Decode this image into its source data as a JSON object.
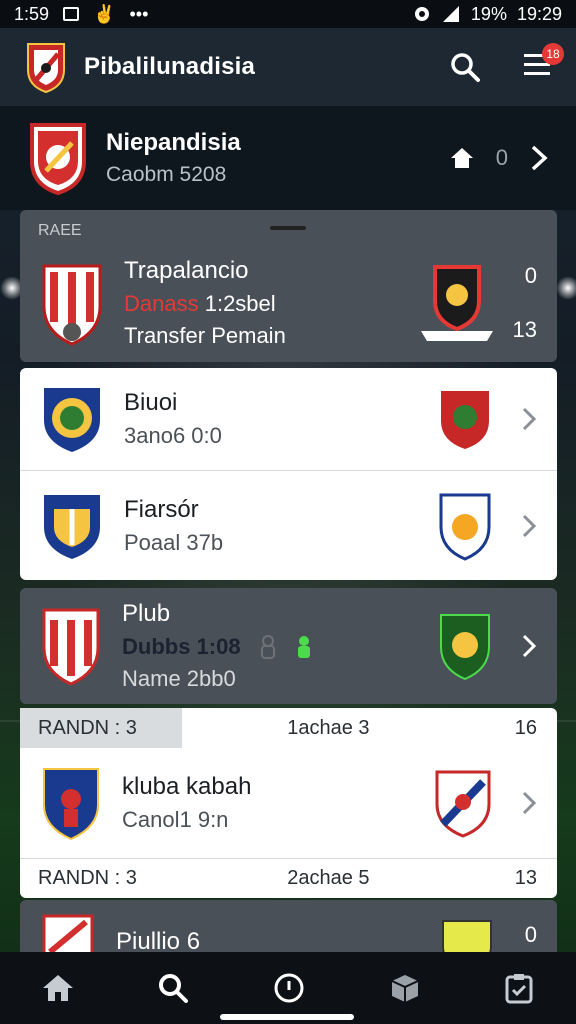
{
  "status_bar": {
    "time_left": "1:59",
    "battery": "19%",
    "time_right": "19:29"
  },
  "app_bar": {
    "title": "Pibalilunadisia",
    "notification_count": "18",
    "icons": [
      "search-icon",
      "menu-icon"
    ]
  },
  "team_header": {
    "name": "Niepandisia",
    "subtitle": "Caobm 5208",
    "count": "0"
  },
  "featured": {
    "section_label": "RAEE",
    "title": "Trapalancio",
    "line2_red": "Danass",
    "line2_rest": "1:2sbel",
    "line3": "Transfer Pemain",
    "score_top": "0",
    "score_bottom": "13",
    "accent_red": "#e53935"
  },
  "clubs_white": [
    {
      "name": "Biuoi",
      "detail": "3ano6 0:0"
    },
    {
      "name": "Fiarsór",
      "detail": "Poaal 37b"
    }
  ],
  "club_dark": {
    "name": "Plub",
    "line2": "Dubbs 1:08",
    "line3": "Name 2bb0"
  },
  "stat_row_1": {
    "label": "RANDN : 3",
    "center": "1achae 3",
    "right": "16"
  },
  "club_kabah": {
    "name": "kluba kabah",
    "detail": "Canol1 9:n"
  },
  "stat_row_2": {
    "label": "RANDN : 3",
    "center": "2achae 5",
    "right": "13"
  },
  "club_partial": {
    "name": "Piullio 6",
    "score": "0"
  },
  "colors": {
    "green_icon": "#4cdb4c",
    "app_bar": "#1e2832",
    "card_dark": "#4a5058"
  }
}
